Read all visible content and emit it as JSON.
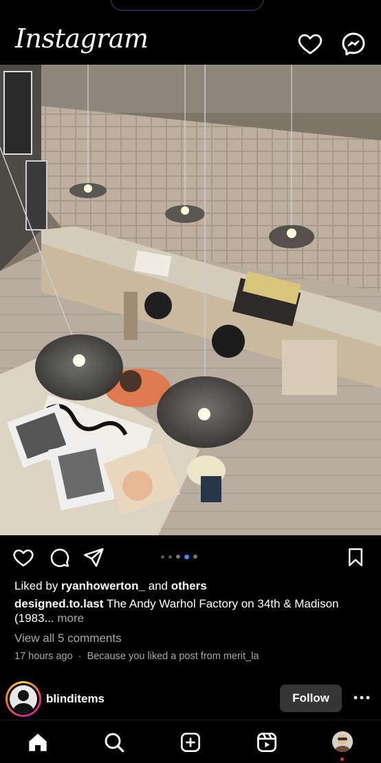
{
  "header": {
    "logo": "Instagram",
    "icons": [
      "heart-icon",
      "messenger-icon"
    ]
  },
  "post": {
    "image_alt_icon": "studio-photo",
    "carousel": {
      "count": 5,
      "active_index": 3
    },
    "likes": {
      "prefix": "Liked by ",
      "user": "ryanhowerton_",
      "middle": " and ",
      "others": "others"
    },
    "caption": {
      "username": "designed.to.last",
      "text": " The Andy Warhol Factory on 34th & Madison (1983...",
      "more": " more"
    },
    "comments_link": "View all 5 comments",
    "time": "17 hours ago",
    "separator": "·",
    "suggestion": "Because you liked a post from merit_la"
  },
  "next_post": {
    "username": "blinditems",
    "follow_label": "Follow"
  },
  "nav": {
    "items": [
      "home-icon",
      "search-icon",
      "create-icon",
      "reels-icon",
      "profile-icon"
    ]
  },
  "colors": {
    "accent": "#3d8bfd",
    "notification": "#ff3040",
    "muted": "#a8a8a8"
  }
}
